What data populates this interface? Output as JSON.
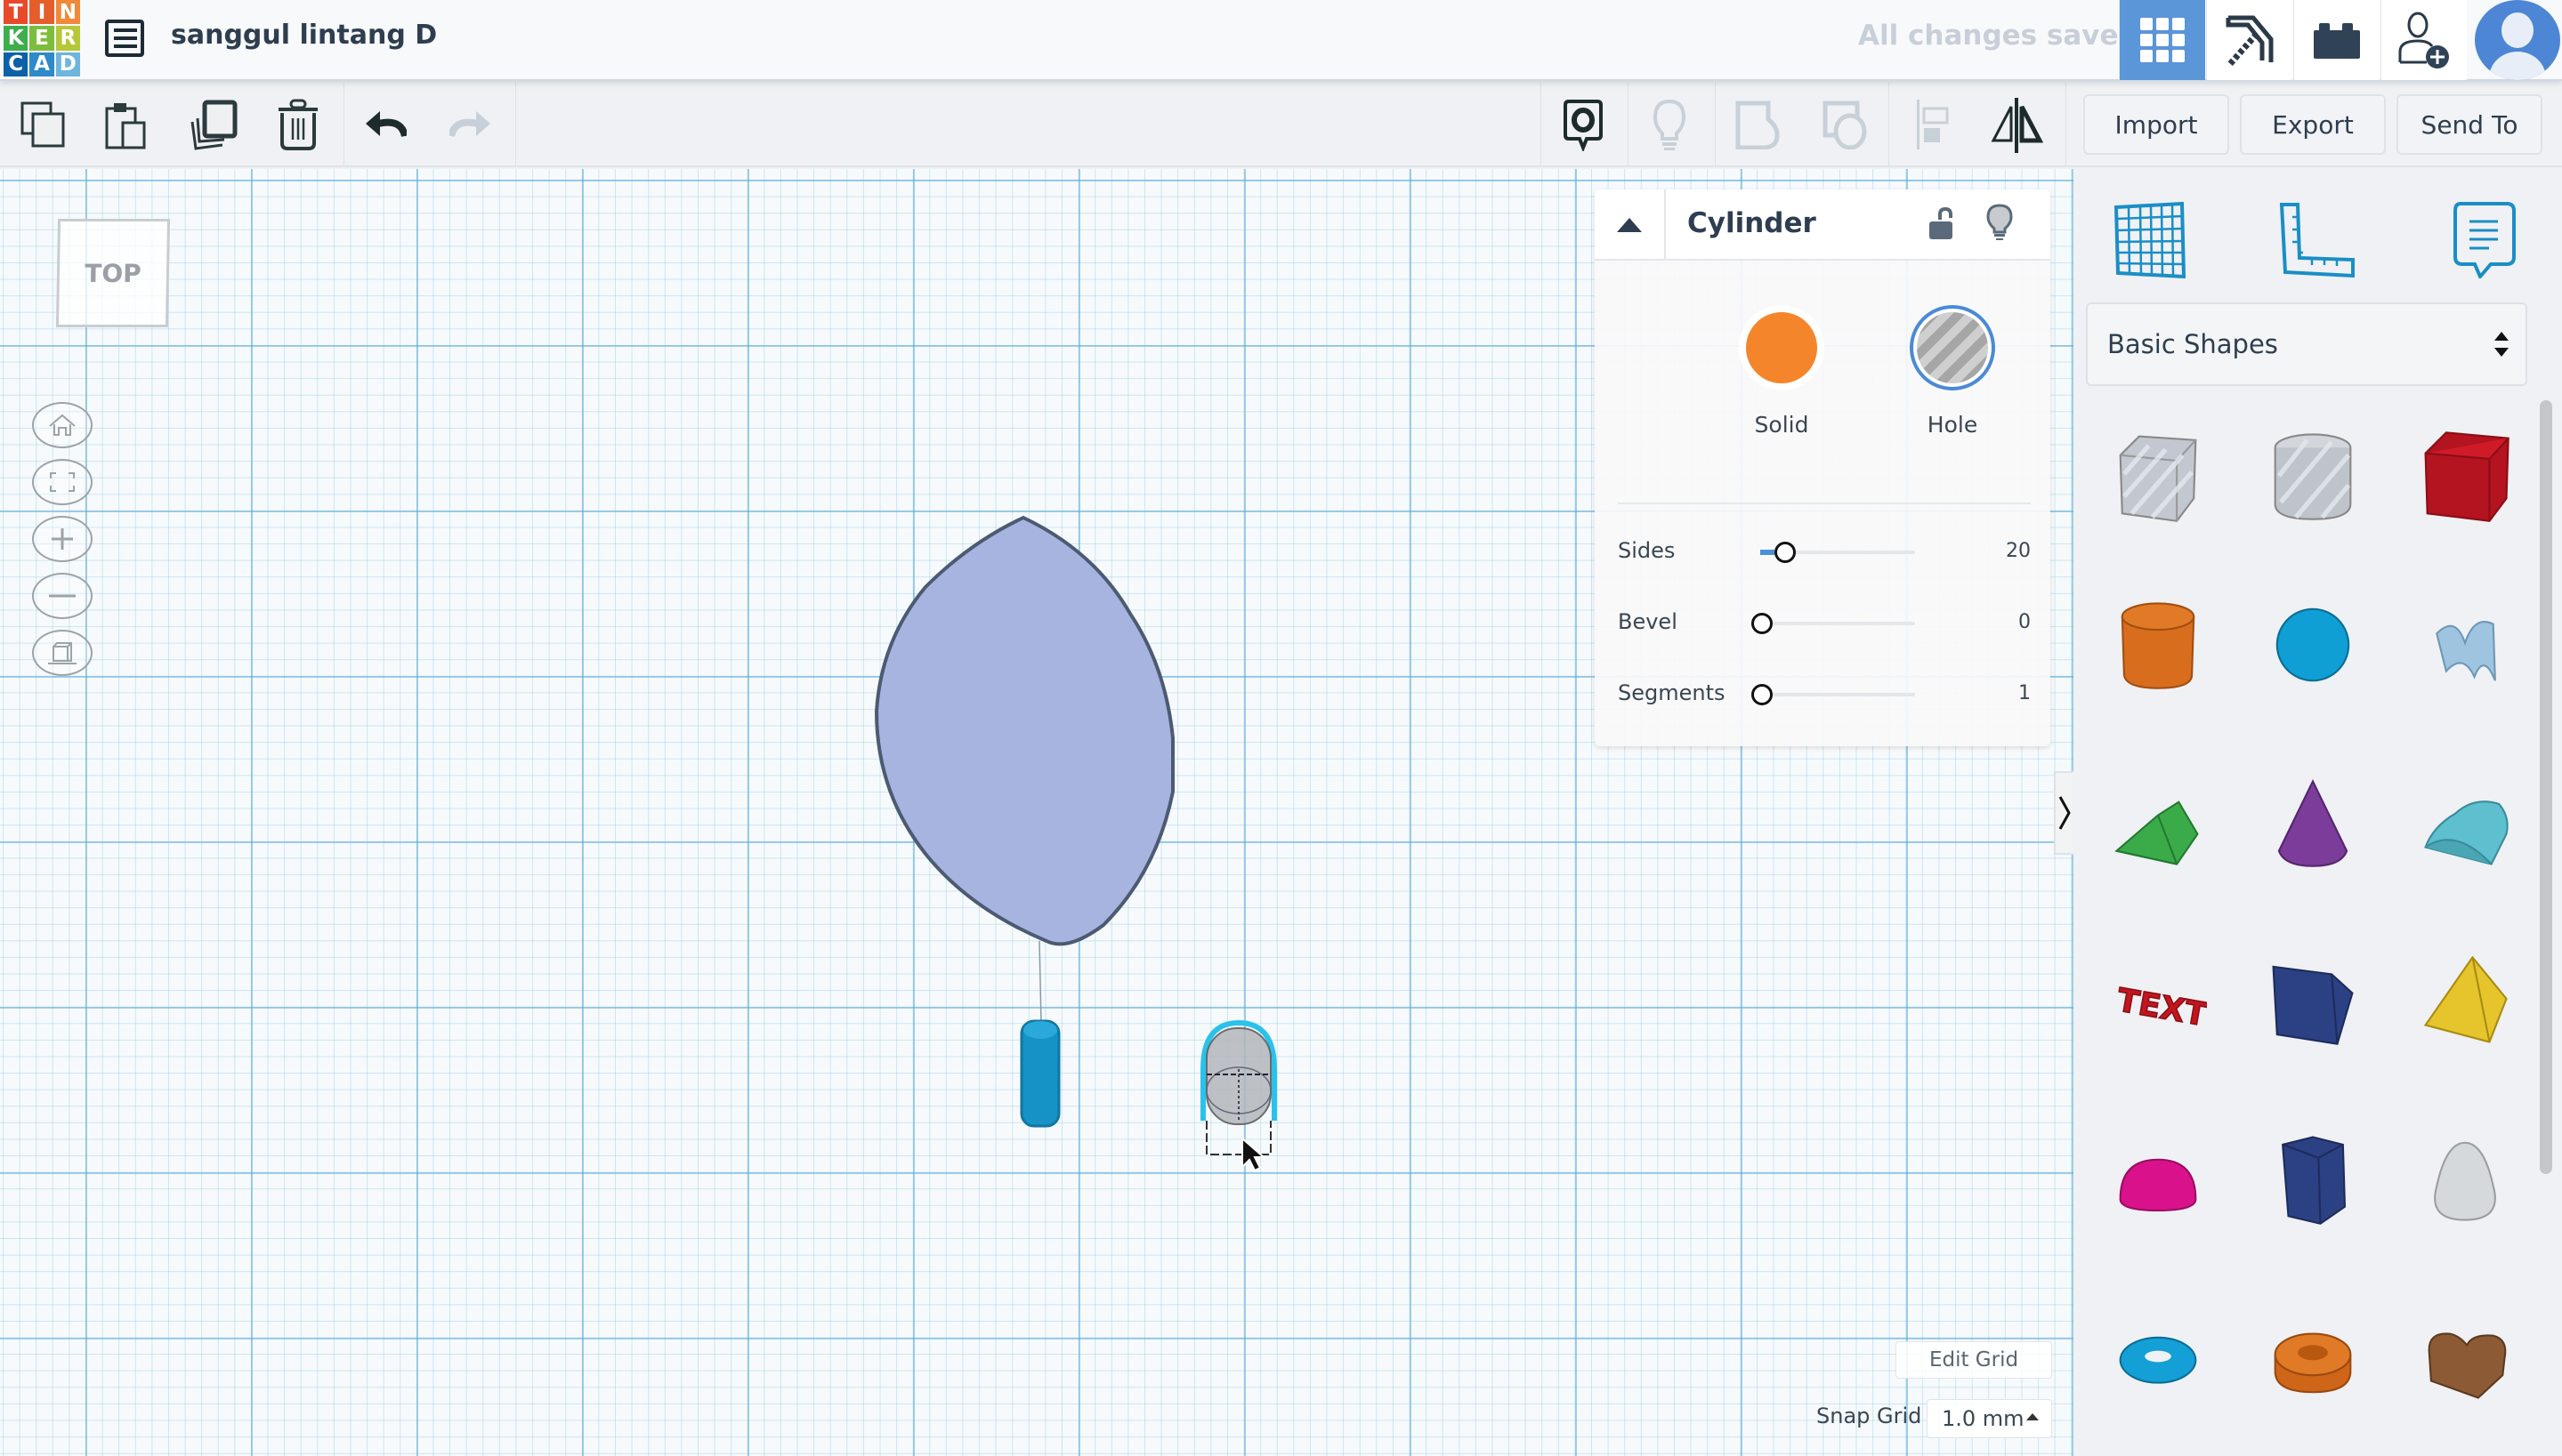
{
  "header": {
    "logo_letters": [
      "T",
      "I",
      "N",
      "K",
      "E",
      "R",
      "C",
      "A",
      "D"
    ],
    "logo_colors": [
      "#e8492b",
      "#e55d2b",
      "#f08a3a",
      "#3eae4c",
      "#7dbd3d",
      "#b6c73a",
      "#0c61a8",
      "#2f8ac9",
      "#6eb5de"
    ],
    "project_title": "sanggul lintang D",
    "save_status": "All changes saved",
    "buttons": [
      {
        "name": "3d-design-view",
        "icon": "grid-icon",
        "active": true
      },
      {
        "name": "minecraft-view",
        "icon": "pickaxe-icon",
        "active": false
      },
      {
        "name": "lego-bricks-view",
        "icon": "brick-icon",
        "active": false
      },
      {
        "name": "invite-user",
        "icon": "add-user-icon",
        "active": false
      }
    ]
  },
  "toolbar": {
    "left_tools": [
      {
        "name": "copy",
        "icon": "copy-icon",
        "enabled": true
      },
      {
        "name": "paste",
        "icon": "paste-icon",
        "enabled": true
      },
      {
        "name": "duplicate",
        "icon": "duplicate-icon",
        "enabled": true
      },
      {
        "name": "delete",
        "icon": "trash-icon",
        "enabled": true
      },
      {
        "name": "undo",
        "icon": "undo-icon",
        "enabled": true
      },
      {
        "name": "redo",
        "icon": "redo-icon",
        "enabled": false
      }
    ],
    "right_tools": [
      {
        "name": "notes-toggle",
        "icon": "eye-bubble-icon",
        "enabled": true
      },
      {
        "name": "show-all",
        "icon": "lightbulb-icon",
        "enabled": false
      },
      {
        "name": "group",
        "icon": "group-icon",
        "enabled": false
      },
      {
        "name": "ungroup",
        "icon": "ungroup-icon",
        "enabled": false
      },
      {
        "name": "align",
        "icon": "align-icon",
        "enabled": false
      },
      {
        "name": "mirror",
        "icon": "mirror-icon",
        "enabled": true
      }
    ],
    "import_label": "Import",
    "export_label": "Export",
    "send_to_label": "Send To"
  },
  "workplane": {
    "view_cube_label": "TOP",
    "nav_controls": [
      "home-view",
      "fit-view",
      "zoom-in",
      "zoom-out",
      "perspective-toggle"
    ],
    "edit_grid_label": "Edit Grid",
    "snap_grid_label": "Snap Grid",
    "snap_grid_value": "1.0 mm",
    "objects": [
      {
        "name": "leaf-shape",
        "color": "#a7b4e0"
      },
      {
        "name": "blue-cylinder",
        "color": "#1b95c9"
      },
      {
        "name": "selected-hole-cylinder",
        "color": "#b9bcc0",
        "selected": true
      }
    ]
  },
  "inspector": {
    "title": "Cylinder",
    "solid_label": "Solid",
    "hole_label": "Hole",
    "solid_color": "#f5852b",
    "selected_mode": "Hole",
    "properties": [
      {
        "label": "Sides",
        "value": "20",
        "fraction": 0.09
      },
      {
        "label": "Bevel",
        "value": "0",
        "fraction": 0.0
      },
      {
        "label": "Segments",
        "value": "1",
        "fraction": 0.0
      }
    ]
  },
  "shapes_panel": {
    "tools": [
      "workplane-tool",
      "ruler-tool",
      "notes-tool"
    ],
    "category": "Basic Shapes",
    "shapes": [
      "Box Hole",
      "Cylinder Hole",
      "Box",
      "Cylinder",
      "Sphere",
      "Scribble",
      "Roof",
      "Cone",
      "Round Roof",
      "Text",
      "Wedge",
      "Pyramid",
      "Half Sphere",
      "Polygon",
      "Paraboloid",
      "Torus",
      "Tube",
      "Heart"
    ]
  }
}
